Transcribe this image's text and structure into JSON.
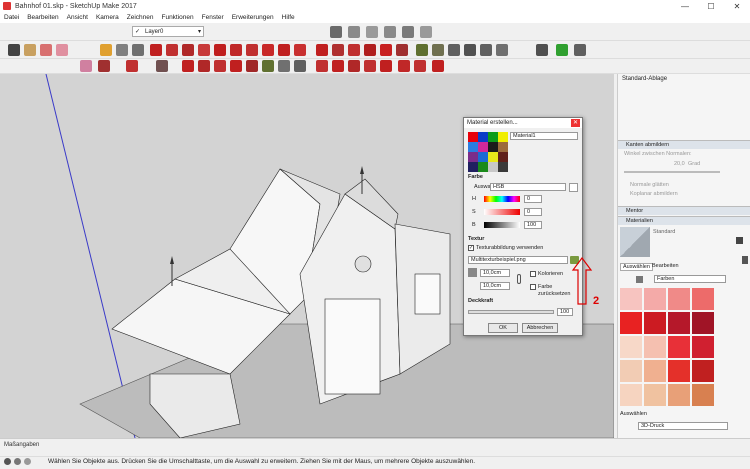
{
  "window": {
    "title": "Bahnhof 01.skp - SketchUp Make 2017",
    "min": "—",
    "max": "☐",
    "close": "✕"
  },
  "menu": [
    "Datei",
    "Bearbeiten",
    "Ansicht",
    "Kamera",
    "Zeichnen",
    "Funktionen",
    "Fenster",
    "Erweiterungen",
    "Hilfe"
  ],
  "layer": {
    "value": "Layer0"
  },
  "dialog": {
    "title": "Material erstellen...",
    "name_value": "Material1",
    "farbe_label": "Farbe",
    "auswahl_label": "Auswahl:",
    "auswahl_value": "HSB",
    "h_label": "H",
    "h_value": "0",
    "s_label": "S",
    "s_value": "0",
    "b_label": "B",
    "b_value": "100",
    "textur_label": "Textur",
    "texture_checkbox_label": "Texturabbildung verwenden",
    "texture_file": "Multitexturbeispiel.png",
    "width_value": "10,0cm",
    "height_value": "10,0cm",
    "kolorieren_label": "Kolorieren",
    "reset_label_1": "Farbe",
    "reset_label_2": "zurücksetzen",
    "opacity_label": "Deckkraft",
    "opacity_value": "100",
    "ok_label": "OK",
    "cancel_label": "Abbrechen",
    "swatch_colors": [
      "#e8000a",
      "#0a3cc8",
      "#0d9c18",
      "#f0ee00",
      "#2a7de0",
      "#d0289a",
      "#1b1b1b",
      "#9c6b3c",
      "#7b2d8a",
      "#1a6ad4",
      "#e8e81a",
      "#60201a",
      "#202060",
      "#1a8a1a",
      "#c8c8c8",
      "#3a3a3a"
    ]
  },
  "tray": {
    "title": "Standard-Ablage",
    "kanten_label": "Kanten abmildern",
    "winkel_label": "Winkel zwischen Normalen:",
    "winkel_value": "20,0",
    "grad_label": "Grad",
    "normale_label": "Normale glätten",
    "koplanar_label": "Koplanar abmildern",
    "mentor_label": "Mentor",
    "materialien_label": "Materialien",
    "standard_label": "Standard",
    "tab_select": "Auswählen",
    "tab_edit": "Bearbeiten",
    "library_value": "Farben",
    "second_select_label": "Auswählen",
    "second_library_value": "3D-Druck",
    "colors": [
      "#f7c4c0",
      "#f4aaa8",
      "#f08a88",
      "#ed6b6a",
      "#e82222",
      "#cc1b22",
      "#b5182a",
      "#a01426",
      "#f7d8c8",
      "#f5c0b0",
      "#e83038",
      "#d02030",
      "#f2ccb4",
      "#f0b090",
      "#e4302a",
      "#c02020",
      "#f6d4c0",
      "#f0c2a0",
      "#e8a078",
      "#d88050"
    ]
  },
  "status": {
    "measure_label": "Maßangaben",
    "message": "Wählen Sie Objekte aus. Drücken Sie die Umschalttaste, um die Auswahl zu erweitern. Ziehen Sie mit der Maus, um mehrere Objekte auszuwählen."
  },
  "annotations": {
    "one": "1",
    "two": "2"
  }
}
